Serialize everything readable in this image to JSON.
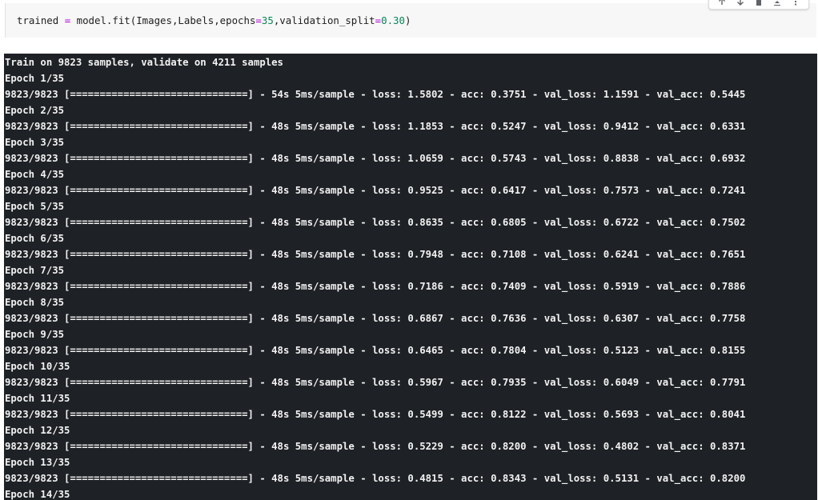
{
  "code_cell": {
    "tokens": [
      {
        "t": "trained",
        "k": "var"
      },
      {
        "t": " ",
        "k": "var"
      },
      {
        "t": "=",
        "k": "op"
      },
      {
        "t": " model.fit(Images,Labels,epochs",
        "k": "fn"
      },
      {
        "t": "=",
        "k": "op"
      },
      {
        "t": "35",
        "k": "num"
      },
      {
        "t": ",validation_split",
        "k": "fn"
      },
      {
        "t": "=",
        "k": "op"
      },
      {
        "t": "0.30",
        "k": "num"
      },
      {
        "t": ")",
        "k": "fn"
      }
    ]
  },
  "toolbar": {
    "icons": [
      "arrow-up-icon",
      "arrow-down-icon",
      "delete-icon",
      "collapse-icon",
      "more-vert-icon"
    ]
  },
  "output": {
    "lines": [
      "Train on 9823 samples, validate on 4211 samples",
      "Epoch 1/35",
      "9823/9823 [==============================] - 54s 5ms/sample - loss: 1.5802 - acc: 0.3751 - val_loss: 1.1591 - val_acc: 0.5445",
      "Epoch 2/35",
      "9823/9823 [==============================] - 48s 5ms/sample - loss: 1.1853 - acc: 0.5247 - val_loss: 0.9412 - val_acc: 0.6331",
      "Epoch 3/35",
      "9823/9823 [==============================] - 48s 5ms/sample - loss: 1.0659 - acc: 0.5743 - val_loss: 0.8838 - val_acc: 0.6932",
      "Epoch 4/35",
      "9823/9823 [==============================] - 48s 5ms/sample - loss: 0.9525 - acc: 0.6417 - val_loss: 0.7573 - val_acc: 0.7241",
      "Epoch 5/35",
      "9823/9823 [==============================] - 48s 5ms/sample - loss: 0.8635 - acc: 0.6805 - val_loss: 0.6722 - val_acc: 0.7502",
      "Epoch 6/35",
      "9823/9823 [==============================] - 48s 5ms/sample - loss: 0.7948 - acc: 0.7108 - val_loss: 0.6241 - val_acc: 0.7651",
      "Epoch 7/35",
      "9823/9823 [==============================] - 48s 5ms/sample - loss: 0.7186 - acc: 0.7409 - val_loss: 0.5919 - val_acc: 0.7886",
      "Epoch 8/35",
      "9823/9823 [==============================] - 48s 5ms/sample - loss: 0.6867 - acc: 0.7636 - val_loss: 0.6307 - val_acc: 0.7758",
      "Epoch 9/35",
      "9823/9823 [==============================] - 48s 5ms/sample - loss: 0.6465 - acc: 0.7804 - val_loss: 0.5123 - val_acc: 0.8155",
      "Epoch 10/35",
      "9823/9823 [==============================] - 48s 5ms/sample - loss: 0.5967 - acc: 0.7935 - val_loss: 0.6049 - val_acc: 0.7791",
      "Epoch 11/35",
      "9823/9823 [==============================] - 48s 5ms/sample - loss: 0.5499 - acc: 0.8122 - val_loss: 0.5693 - val_acc: 0.8041",
      "Epoch 12/35",
      "9823/9823 [==============================] - 48s 5ms/sample - loss: 0.5229 - acc: 0.8200 - val_loss: 0.4802 - val_acc: 0.8371",
      "Epoch 13/35",
      "9823/9823 [==============================] - 48s 5ms/sample - loss: 0.4815 - acc: 0.8343 - val_loss: 0.5131 - val_acc: 0.8200",
      "Epoch 14/35"
    ]
  },
  "colors": {
    "output_bg": "#1e2125",
    "output_text": "#f2f2f2",
    "code_bg": "#f7f7f7",
    "operator": "#af00db",
    "number": "#098658"
  }
}
